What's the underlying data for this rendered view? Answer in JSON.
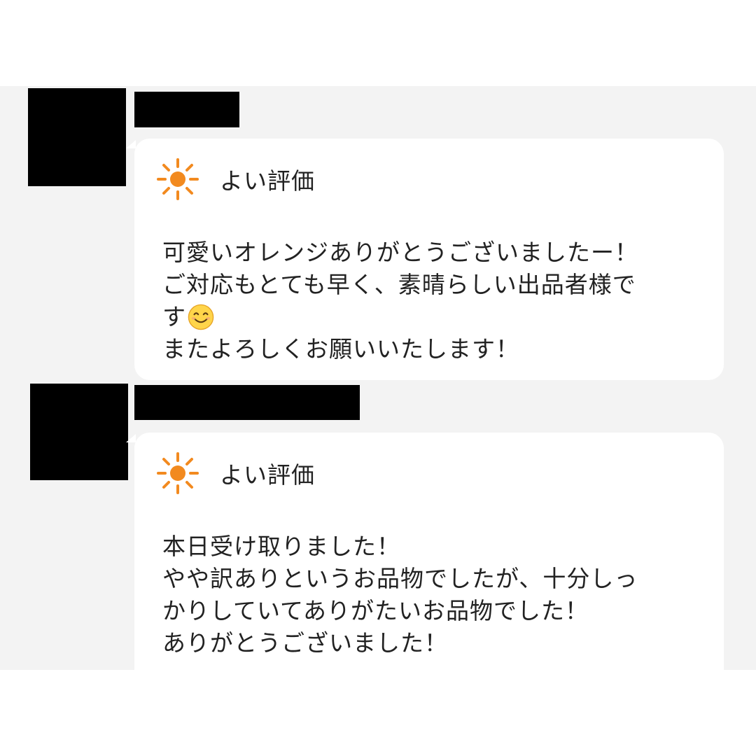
{
  "reviews": [
    {
      "rating": {
        "icon": "sun-icon",
        "label": "よい評価",
        "color": "#f28a1f"
      },
      "comment_lines": [
        "可愛いオレンジありがとうございましたー！",
        "ご対応もとても早く、素晴らしい出品者様で",
        "す",
        "またよろしくお願いいたします！"
      ],
      "emoji": "smiling-face-icon"
    },
    {
      "rating": {
        "icon": "sun-icon",
        "label": "よい評価",
        "color": "#f28a1f"
      },
      "comment_lines": [
        "本日受け取りました！",
        "やや訳ありというお品物でしたが、十分しっ",
        "かりしていてありがたいお品物でした！",
        "ありがとうございました！"
      ]
    }
  ],
  "colors": {
    "background": "#f3f3f3",
    "bubble": "#ffffff",
    "text": "#222222",
    "redaction": "#000000"
  }
}
